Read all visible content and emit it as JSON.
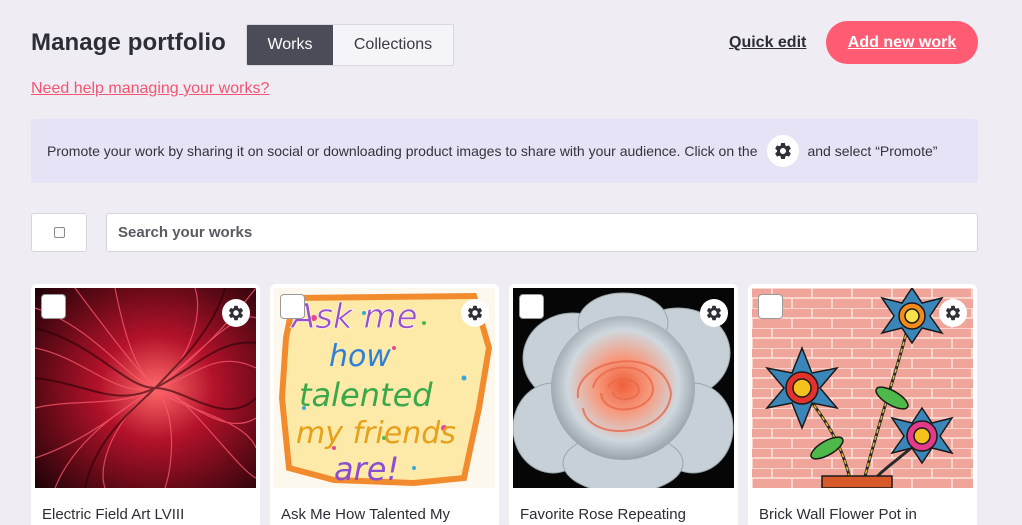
{
  "header": {
    "title": "Manage portfolio",
    "tabs": [
      {
        "label": "Works",
        "active": true
      },
      {
        "label": "Collections",
        "active": false
      }
    ],
    "quick_edit_label": "Quick edit",
    "add_new_label": "Add new work"
  },
  "help_link": "Need help managing your works?",
  "promo": {
    "text_before": "Promote your work by sharing it on social or downloading product images to share with your audience. Click on the",
    "text_after": "and select “Promote”",
    "icon": "gear-icon"
  },
  "search": {
    "placeholder": "Search your works"
  },
  "works": [
    {
      "title": "Electric Field Art LVIII"
    },
    {
      "title": "Ask Me How Talented My"
    },
    {
      "title": "Favorite Rose Repeating"
    },
    {
      "title": "Brick Wall Flower Pot in"
    }
  ],
  "colors": {
    "accent": "#ff5b73",
    "link": "#f25472",
    "active_tab": "#4a4d57",
    "promo_bg": "#e5e3f5",
    "page_bg": "#efedf3"
  }
}
